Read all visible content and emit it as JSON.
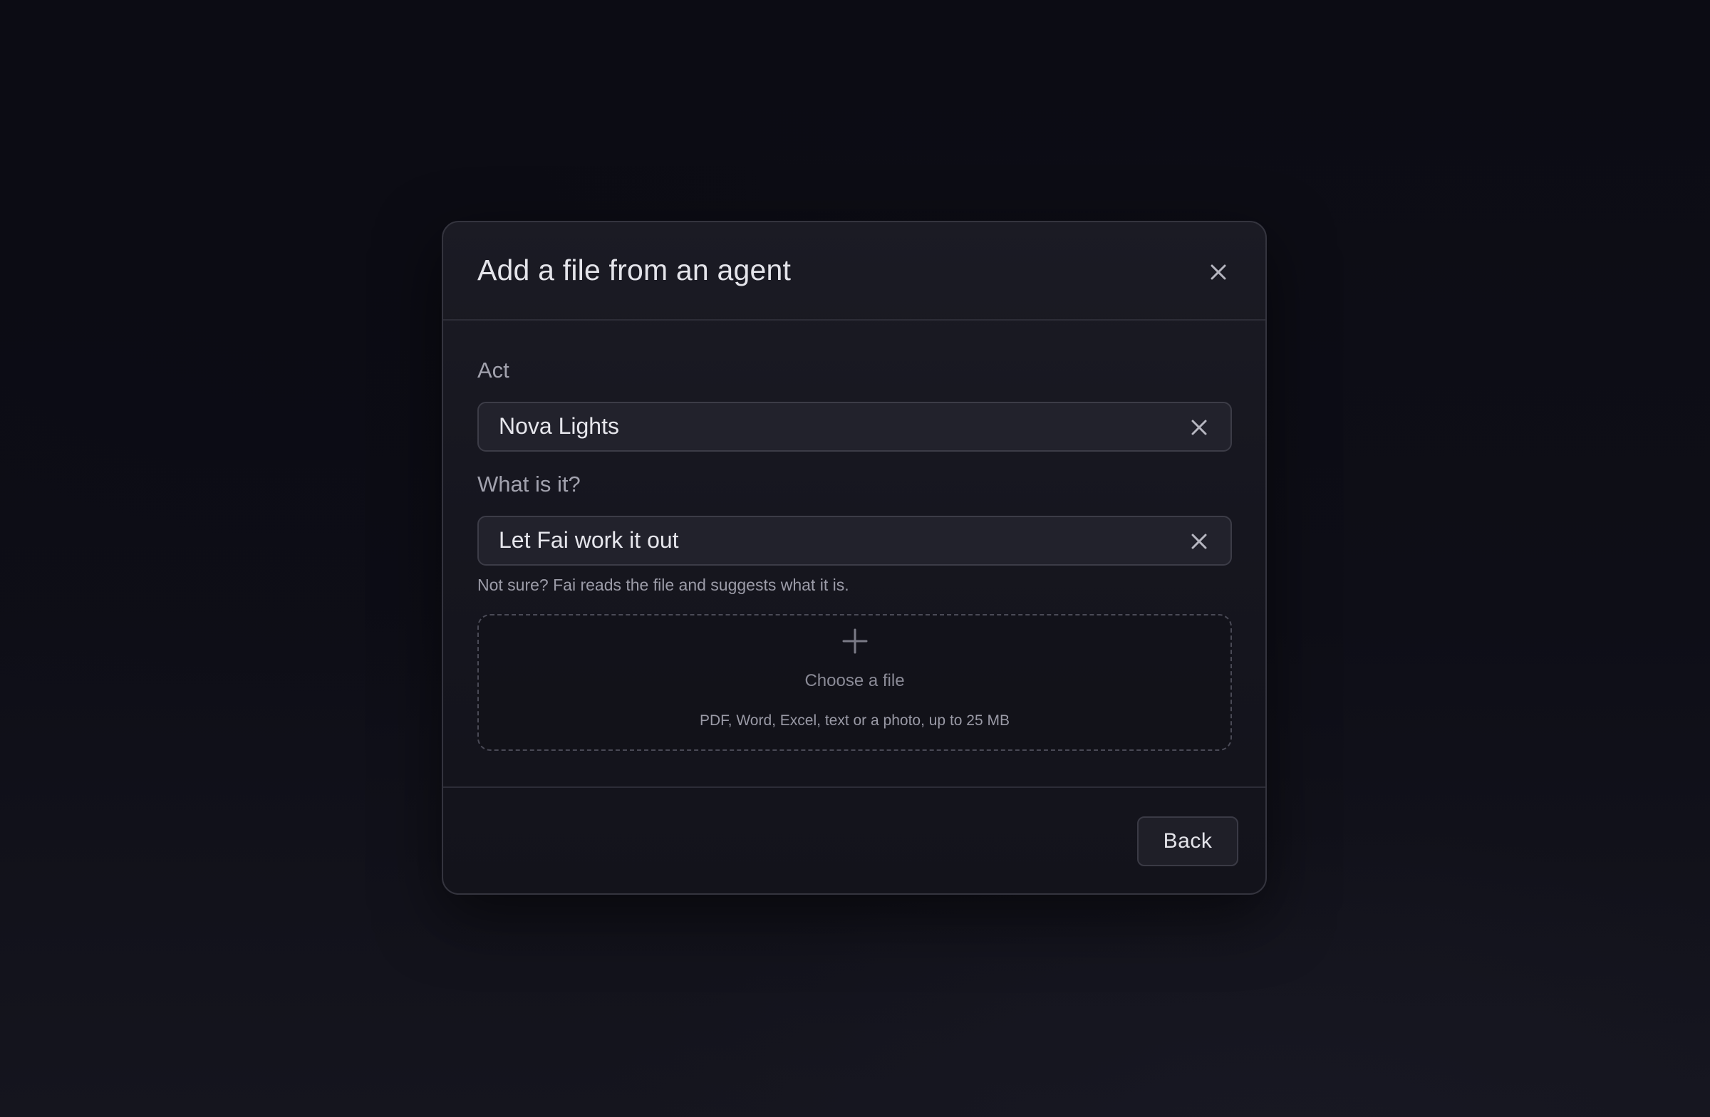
{
  "dialog": {
    "title": "Add a file from an agent",
    "close_icon": "close-icon"
  },
  "fields": {
    "act": {
      "label": "Act",
      "value": "Nova Lights",
      "clear_icon": "clear-icon"
    },
    "type": {
      "label": "What is it?",
      "value": "Let Fai work it out",
      "clear_icon": "clear-icon",
      "helper": "Not sure? Fai reads the file and suggests what it is."
    }
  },
  "dropzone": {
    "icon": "plus-icon",
    "title": "Choose a file",
    "subtitle": "PDF, Word, Excel, text or a photo, up to 25 MB"
  },
  "footer": {
    "back_label": "Back"
  },
  "colors": {
    "background": "#0e0e17",
    "dialog_surface": "#1b1b24",
    "field_surface": "#22222c",
    "text_primary": "#e4e4ea",
    "text_muted": "#9c9ca8"
  }
}
